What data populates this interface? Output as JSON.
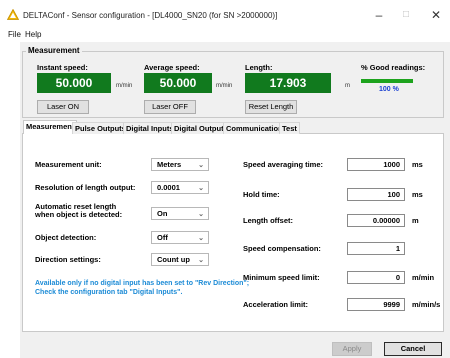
{
  "window": {
    "title": "DELTAConf - Sensor configuration - [DL4000_SN20 (for SN >2000000)]",
    "accent_color": "#f2b705"
  },
  "menu": [
    "File",
    "Help"
  ],
  "measurement": {
    "group_title": "Measurement",
    "instant_speed": {
      "label": "Instant speed:",
      "value": "50.000",
      "unit": "m/min"
    },
    "average_speed": {
      "label": "Average speed:",
      "value": "50.000",
      "unit": "m/min"
    },
    "length": {
      "label": "Length:",
      "value": "17.903",
      "unit": "m"
    },
    "good_readings": {
      "label": "% Good readings:",
      "value": "100 %",
      "fraction": 1.0
    },
    "laser_on_label": "Laser ON",
    "laser_off_label": "Laser OFF",
    "reset_length_label": "Reset Length",
    "display_color": "#117a1e"
  },
  "tabs": [
    "Measurement",
    "Pulse Outputs",
    "Digital Inputs",
    "Digital Outputs",
    "Communication",
    "Test"
  ],
  "active_tab": "Measurement",
  "settings_left": {
    "measurement_unit": {
      "label": "Measurement unit:",
      "value": "Meters"
    },
    "resolution": {
      "label": "Resolution of length output:",
      "value": "0.0001"
    },
    "auto_reset": {
      "label_line1": "Automatic reset length",
      "label_line2": "when object is detected:",
      "value": "On"
    },
    "object_detection": {
      "label": "Object detection:",
      "value": "Off"
    },
    "direction": {
      "label": "Direction settings:",
      "value": "Count up"
    },
    "note_line1": "Available only if no digital input has been set to \"Rev Direction\";",
    "note_line2": "Check the configuration tab \"Digital Inputs\"."
  },
  "settings_right": {
    "speed_avg_time": {
      "label": "Speed averaging time:",
      "value": "1000",
      "unit": "ms"
    },
    "hold_time": {
      "label": "Hold time:",
      "value": "100",
      "unit": "ms"
    },
    "length_offset": {
      "label": "Length offset:",
      "value": "0.00000",
      "unit": "m"
    },
    "speed_comp": {
      "label": "Speed compensation:",
      "value": "1"
    },
    "min_speed": {
      "label": "Minimum speed limit:",
      "value": "0",
      "unit": "m/min"
    },
    "accel_limit": {
      "label": "Acceleration limit:",
      "value": "9999",
      "unit": "m/min/s"
    }
  },
  "footer": {
    "apply_label": "Apply",
    "cancel_label": "Cancel"
  }
}
